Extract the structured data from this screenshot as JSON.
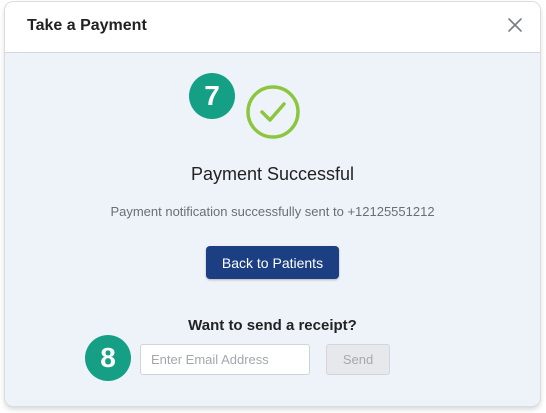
{
  "modal": {
    "title": "Take a Payment",
    "close_icon": "close-icon"
  },
  "steps": {
    "payment_step": "7",
    "receipt_step": "8",
    "badge_color": "#15a085"
  },
  "success": {
    "icon": "checkmark-circle-icon",
    "icon_color": "#8cc63f",
    "title": "Payment Successful",
    "message": "Payment notification successfully sent to +12125551212"
  },
  "actions": {
    "back_label": "Back to Patients",
    "back_color": "#1c3e82"
  },
  "receipt": {
    "title": "Want to send a receipt?",
    "email_value": "",
    "email_placeholder": "Enter Email Address",
    "send_label": "Send"
  }
}
